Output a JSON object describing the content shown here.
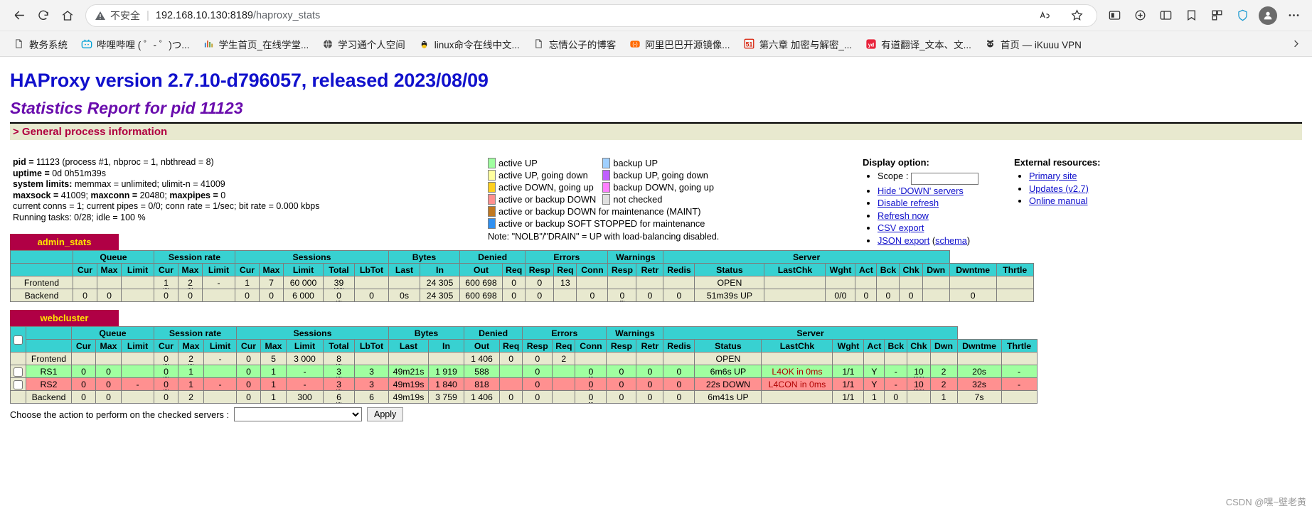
{
  "browser": {
    "security_label": "不安全",
    "url_host": "192.168.10.130:8189",
    "url_path": "/haproxy_stats",
    "bookmarks": [
      {
        "label": "教务系统",
        "icon": "page-icon"
      },
      {
        "label": "哔哩哔哩 ( ゜- ゜)つ...",
        "icon": "bilibili-icon"
      },
      {
        "label": "学生首页_在线学堂...",
        "icon": "chart-icon"
      },
      {
        "label": "学习通个人空间",
        "icon": "globe-icon"
      },
      {
        "label": "linux命令在线中文...",
        "icon": "tux-icon"
      },
      {
        "label": "忘情公子的博客",
        "icon": "page-icon"
      },
      {
        "label": "阿里巴巴开源镜像...",
        "icon": "alibaba-icon"
      },
      {
        "label": "第六章 加密与解密_...",
        "icon": "fiveone-icon"
      },
      {
        "label": "有道翻译_文本、文...",
        "icon": "youdao-icon"
      },
      {
        "label": "首页 — iKuuu VPN",
        "icon": "cat-icon"
      }
    ]
  },
  "header": {
    "title": "HAProxy version 2.7.10-d796057, released 2023/08/09",
    "subtitle": "Statistics Report for pid 11123",
    "section": "> General process information"
  },
  "process_info": {
    "line1_label": "pid = ",
    "line1_value": "11123 (process #1, nbproc = 1, nbthread = 8)",
    "line2_label": "uptime = ",
    "line2_value": "0d 0h51m39s",
    "line3_label": "system limits:",
    "line3_value": " memmax = unlimited; ulimit-n = 41009",
    "line4_a": "maxsock = ",
    "line4_b": "41009; ",
    "line4_c": "maxconn = ",
    "line4_d": "20480; ",
    "line4_e": "maxpipes = ",
    "line4_f": "0",
    "line5": "current conns = 1; current pipes = 0/0; conn rate = 1/sec; bit rate = 0.000 kbps",
    "line6": "Running tasks: 0/28; idle = 100 %"
  },
  "legend": {
    "left": [
      {
        "label": "active UP",
        "color": "#a0ffa0"
      },
      {
        "label": "active UP, going down",
        "color": "#ffffa0"
      },
      {
        "label": "active DOWN, going up",
        "color": "#ffd020"
      },
      {
        "label": "active or backup DOWN",
        "color": "#ff9090"
      },
      {
        "label": "active or backup DOWN for maintenance (MAINT)",
        "color": "#c07820"
      },
      {
        "label": "active or backup SOFT STOPPED for maintenance",
        "color": "#3090f0"
      }
    ],
    "right": [
      {
        "label": "backup UP",
        "color": "#a0d0ff"
      },
      {
        "label": "backup UP, going down",
        "color": "#c060ff"
      },
      {
        "label": "backup DOWN, going up",
        "color": "#ff80ff"
      },
      {
        "label": "not checked",
        "color": "#e0e0e0"
      }
    ],
    "note": "Note: \"NOLB\"/\"DRAIN\" = UP with load-balancing disabled."
  },
  "display_option": {
    "title": "Display option:",
    "scope_label": "Scope :",
    "scope_value": "",
    "links": [
      "Hide 'DOWN' servers",
      "Disable refresh",
      "Refresh now",
      "CSV export"
    ],
    "json_export": "JSON export",
    "json_schema_pre": "(",
    "json_schema": "schema",
    "json_schema_post": ")"
  },
  "external_resources": {
    "title": "External resources:",
    "links": [
      "Primary site",
      "Updates (v2.7)",
      "Online manual"
    ]
  },
  "tables": [
    {
      "name": "admin_stats",
      "has_checkbox": false,
      "group_headers": [
        {
          "label": "",
          "span": 1
        },
        {
          "label": "Queue",
          "span": 3
        },
        {
          "label": "Session rate",
          "span": 3
        },
        {
          "label": "Sessions",
          "span": 5
        },
        {
          "label": "Bytes",
          "span": 2
        },
        {
          "label": "Denied",
          "span": 2
        },
        {
          "label": "Errors",
          "span": 3
        },
        {
          "label": "Warnings",
          "span": 2
        },
        {
          "label": "Server",
          "span": 8
        }
      ],
      "sub_headers": [
        "",
        "Cur",
        "Max",
        "Limit",
        "Cur",
        "Max",
        "Limit",
        "Cur",
        "Max",
        "Limit",
        "Total",
        "LbTot",
        "Last",
        "In",
        "Out",
        "Req",
        "Resp",
        "Req",
        "Conn",
        "Resp",
        "Retr",
        "Redis",
        "Status",
        "LastChk",
        "Wght",
        "Act",
        "Bck",
        "Chk",
        "Dwn",
        "Dwntme",
        "Thrtle"
      ],
      "rows": [
        {
          "type": "frontend",
          "cells": [
            "Frontend",
            "",
            "",
            "",
            "1",
            "2",
            "-",
            "1",
            "7",
            "60 000",
            "39",
            "",
            "",
            "24 305",
            "600 698",
            "0",
            "0",
            "13",
            "",
            "",
            "",
            "",
            "OPEN",
            "",
            "",
            "",
            "",
            "",
            "",
            "",
            ""
          ],
          "underline": [
            4,
            5,
            10
          ]
        },
        {
          "type": "backend",
          "cells": [
            "Backend",
            "0",
            "0",
            "",
            "0",
            "0",
            "",
            "0",
            "0",
            "6 000",
            "0",
            "0",
            "0s",
            "24 305",
            "600 698",
            "0",
            "0",
            "",
            "0",
            "0",
            "0",
            "0",
            "51m39s UP",
            "",
            "0/0",
            "0",
            "0",
            "0",
            "",
            "0",
            ""
          ],
          "underline": [
            10,
            19
          ]
        }
      ]
    },
    {
      "name": "webcluster",
      "has_checkbox": true,
      "group_headers": [
        {
          "label": "",
          "span": 1
        },
        {
          "label": "",
          "span": 1
        },
        {
          "label": "Queue",
          "span": 3
        },
        {
          "label": "Session rate",
          "span": 3
        },
        {
          "label": "Sessions",
          "span": 5
        },
        {
          "label": "Bytes",
          "span": 2
        },
        {
          "label": "Denied",
          "span": 2
        },
        {
          "label": "Errors",
          "span": 3
        },
        {
          "label": "Warnings",
          "span": 2
        },
        {
          "label": "Server",
          "span": 8
        }
      ],
      "sub_headers": [
        "",
        "",
        "Cur",
        "Max",
        "Limit",
        "Cur",
        "Max",
        "Limit",
        "Cur",
        "Max",
        "Limit",
        "Total",
        "LbTot",
        "Last",
        "In",
        "Out",
        "Req",
        "Resp",
        "Req",
        "Conn",
        "Resp",
        "Retr",
        "Redis",
        "Status",
        "LastChk",
        "Wght",
        "Act",
        "Bck",
        "Chk",
        "Dwn",
        "Dwntme",
        "Thrtle"
      ],
      "rows": [
        {
          "type": "frontend",
          "checkbox": false,
          "cells": [
            "Frontend",
            "",
            "",
            "",
            "0",
            "2",
            "-",
            "0",
            "5",
            "3 000",
            "8",
            "",
            "",
            "1 406",
            "0",
            "0",
            "2",
            "",
            "",
            "",
            "",
            "OPEN",
            "",
            "",
            "",
            "",
            "",
            "",
            "",
            ""
          ],
          "display": [
            "Frontend",
            "",
            "",
            "",
            "0",
            "2",
            "-",
            "0",
            "5",
            "3 000",
            "8",
            "",
            "",
            "1 406",
            "0",
            "0",
            "2",
            "",
            "",
            "",
            "",
            "OPEN",
            "",
            "",
            "",
            "",
            "",
            "",
            "",
            ""
          ]
        },
        {
          "type": "up",
          "checkbox": true,
          "server": "RS1",
          "cells": [
            "0",
            "0",
            "",
            "0",
            "1",
            "",
            "0",
            "1",
            "-",
            "3",
            "3",
            "49m21s",
            "1 919",
            "588",
            "",
            "0",
            "",
            "0",
            "0",
            "0",
            "0",
            "6m6s UP",
            "L4OK in 0ms",
            "1/1",
            "Y",
            "-",
            "10",
            "2",
            "20s",
            "-"
          ]
        },
        {
          "type": "down",
          "checkbox": true,
          "server": "RS2",
          "cells": [
            "0",
            "0",
            "-",
            "0",
            "1",
            "-",
            "0",
            "1",
            "-",
            "3",
            "3",
            "49m19s",
            "1 840",
            "818",
            "",
            "0",
            "",
            "0",
            "0",
            "0",
            "0",
            "22s DOWN",
            "L4CON in 0ms",
            "1/1",
            "Y",
            "-",
            "10",
            "2",
            "32s",
            "-"
          ]
        },
        {
          "type": "backend",
          "checkbox": false,
          "cells": [
            "Backend",
            "0",
            "0",
            "",
            "0",
            "2",
            "",
            "0",
            "1",
            "300",
            "6",
            "6",
            "49m19s",
            "3 759",
            "1 406",
            "0",
            "0",
            "",
            "0",
            "0",
            "0",
            "0",
            "6m41s UP",
            "",
            "1/1",
            "1",
            "0",
            "",
            "1",
            "7s",
            ""
          ]
        }
      ]
    }
  ],
  "webcluster_rows_full": {
    "frontend": [
      "Frontend",
      "",
      "",
      "",
      "0",
      "2",
      "-",
      "0",
      "5",
      "3 000",
      "8",
      "",
      "",
      "",
      "1 406",
      "0",
      "0",
      "2",
      "",
      "",
      "",
      "",
      "OPEN",
      "",
      "",
      "",
      "",
      "",
      "",
      "",
      ""
    ],
    "rs1": [
      "RS1",
      "0",
      "0",
      "",
      "0",
      "1",
      "",
      "0",
      "1",
      "-",
      "3",
      "3",
      "49m21s",
      "1 919",
      "588",
      "",
      "0",
      "",
      "0",
      "0",
      "0",
      "0",
      "6m6s UP",
      "L4OK in 0ms",
      "1/1",
      "Y",
      "-",
      "10",
      "2",
      "20s",
      "-"
    ],
    "rs2": [
      "RS2",
      "0",
      "0",
      "-",
      "0",
      "1",
      "-",
      "0",
      "1",
      "-",
      "3",
      "3",
      "49m19s",
      "1 840",
      "818",
      "",
      "0",
      "",
      "0",
      "0",
      "0",
      "0",
      "22s DOWN",
      "L4CON in 0ms",
      "1/1",
      "Y",
      "-",
      "10",
      "2",
      "32s",
      "-"
    ],
    "backend": [
      "Backend",
      "0",
      "0",
      "",
      "0",
      "2",
      "",
      "0",
      "1",
      "300",
      "6",
      "6",
      "49m19s",
      "3 759",
      "1 406",
      "0",
      "0",
      "",
      "0",
      "0",
      "0",
      "0",
      "6m41s UP",
      "",
      "1/1",
      "1",
      "0",
      "",
      "1",
      "7s",
      ""
    ]
  },
  "footer": {
    "action_label": "Choose the action to perform on the checked servers :",
    "action_value": "",
    "apply_label": "Apply",
    "watermark": "CSDN @嘿~壁老黄"
  }
}
